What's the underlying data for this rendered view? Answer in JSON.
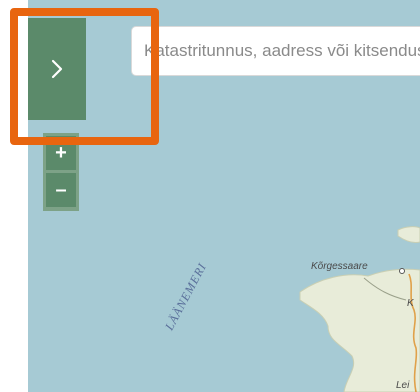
{
  "sidebar_toggle": {
    "icon": "chevron-right-icon"
  },
  "search": {
    "placeholder": "Katastritunnus, aadress või kitsendus"
  },
  "zoom": {
    "in_label": "+",
    "out_label": "–"
  },
  "map": {
    "sea_label": "LÄÄNEMERI",
    "places": [
      "Kõrgessaare",
      "K",
      "Lei"
    ]
  },
  "colors": {
    "water": "#a6cad4",
    "land": "#e8ecd9",
    "button": "#5b8a6a",
    "highlight": "#e8650f"
  }
}
